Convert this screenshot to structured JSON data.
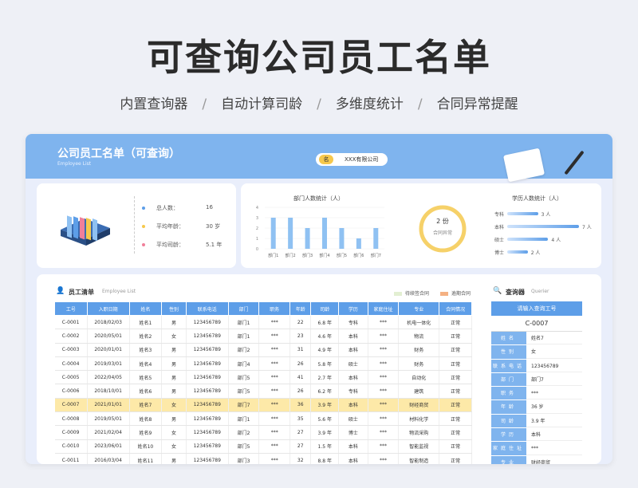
{
  "hero": {
    "title": "可查询公司员工名单",
    "features": [
      "内置查询器",
      "自动计算司龄",
      "多维度统计",
      "合同异常提醒"
    ],
    "separator": "/"
  },
  "banner": {
    "title": "公司员工名单（可查询）",
    "subtitle": "Employee List",
    "company_tag": "名",
    "company_name": "XXX有限公司"
  },
  "stats": {
    "items": [
      {
        "label": "总人数：",
        "value": "16",
        "color": "#5d9ee8"
      },
      {
        "label": "平均年龄：",
        "value": "30 岁",
        "color": "#f6c84c"
      },
      {
        "label": "平均司龄：",
        "value": "5.1 年",
        "color": "#f07f9a"
      }
    ]
  },
  "dept_chart": {
    "title": "部门人数统计（人）"
  },
  "contract": {
    "value": "2 份",
    "label": "合同异常"
  },
  "edu_chart": {
    "title": "学历人数统计（人）"
  },
  "chart_data": [
    {
      "type": "bar",
      "title": "部门人数统计（人）",
      "categories": [
        "部门1",
        "部门2",
        "部门3",
        "部门4",
        "部门5",
        "部门6",
        "部门7"
      ],
      "values": [
        3,
        3,
        2,
        3,
        2,
        1,
        2
      ],
      "ylim": [
        0,
        4
      ],
      "yticks": [
        "0",
        "1",
        "2",
        "3",
        "4"
      ]
    },
    {
      "type": "bar",
      "orientation": "horizontal",
      "title": "学历人数统计（人）",
      "categories": [
        "专科",
        "本科",
        "硕士",
        "博士"
      ],
      "values": [
        3,
        7,
        4,
        2
      ],
      "value_labels": [
        "3 人",
        "7 人",
        "4 人",
        "2 人"
      ]
    }
  ],
  "table": {
    "title": "员工清单",
    "title_en": "Employee List",
    "legend": [
      {
        "label": "待续签合同",
        "color": "#e3efd2"
      },
      {
        "label": "逾期合同",
        "color": "#f4b183"
      }
    ],
    "headers": [
      "工号",
      "入职日期",
      "姓名",
      "性别",
      "联系电话",
      "部门",
      "职务",
      "年龄",
      "司龄",
      "学历",
      "家庭住址",
      "专业",
      "合同情况"
    ],
    "rows": [
      [
        "C-0001",
        "2018/02/03",
        "姓名1",
        "男",
        "123456789",
        "部门1",
        "***",
        "22",
        "6.8 年",
        "专科",
        "***",
        "机电一体化",
        "正常"
      ],
      [
        "C-0002",
        "2020/05/01",
        "姓名2",
        "女",
        "123456789",
        "部门1",
        "***",
        "23",
        "4.6 年",
        "本科",
        "***",
        "物流",
        "正常"
      ],
      [
        "C-0003",
        "2020/01/01",
        "姓名3",
        "男",
        "123456789",
        "部门2",
        "***",
        "31",
        "4.9 年",
        "本科",
        "***",
        "财务",
        "正常"
      ],
      [
        "C-0004",
        "2019/03/01",
        "姓名4",
        "男",
        "123456789",
        "部门4",
        "***",
        "26",
        "5.8 年",
        "硕士",
        "***",
        "财务",
        "正常"
      ],
      [
        "C-0005",
        "2022/04/05",
        "姓名5",
        "男",
        "123456789",
        "部门5",
        "***",
        "41",
        "2.7 年",
        "本科",
        "***",
        "自动化",
        "正常"
      ],
      [
        "C-0006",
        "2018/10/01",
        "姓名6",
        "男",
        "123456789",
        "部门5",
        "***",
        "26",
        "6.2 年",
        "专科",
        "***",
        "建筑",
        "正常"
      ],
      [
        "C-0007",
        "2021/01/01",
        "姓名7",
        "女",
        "123456789",
        "部门7",
        "***",
        "36",
        "3.9 年",
        "本科",
        "***",
        "财经商贸",
        "正常"
      ],
      [
        "C-0008",
        "2019/05/01",
        "姓名8",
        "男",
        "123456789",
        "部门1",
        "***",
        "35",
        "5.6 年",
        "硕士",
        "***",
        "材料化学",
        "正常"
      ],
      [
        "C-0009",
        "2021/02/04",
        "姓名9",
        "女",
        "123456789",
        "部门2",
        "***",
        "27",
        "3.9 年",
        "博士",
        "***",
        "物流采购",
        "正常"
      ],
      [
        "C-0010",
        "2023/06/01",
        "姓名10",
        "女",
        "123456789",
        "部门5",
        "***",
        "27",
        "1.5 年",
        "本科",
        "***",
        "智能监视",
        "正常"
      ],
      [
        "C-0011",
        "2016/03/04",
        "姓名11",
        "男",
        "123456789",
        "部门3",
        "***",
        "32",
        "8.8 年",
        "本科",
        "***",
        "智能制造",
        "正常"
      ]
    ],
    "highlight_row": 6
  },
  "query": {
    "title": "查询器",
    "title_en": "Querier",
    "prompt": "请输入查询工号",
    "id": "C-0007",
    "fields": [
      {
        "label": "姓名",
        "value": "姓名7"
      },
      {
        "label": "性别",
        "value": "女"
      },
      {
        "label": "联系电话",
        "value": "123456789"
      },
      {
        "label": "部门",
        "value": "部门7"
      },
      {
        "label": "职务",
        "value": "***"
      },
      {
        "label": "年龄",
        "value": "36 岁"
      },
      {
        "label": "司龄",
        "value": "3.9 年"
      },
      {
        "label": "学历",
        "value": "本科"
      },
      {
        "label": "家庭住址",
        "value": "***"
      },
      {
        "label": "专业",
        "value": "财经商贸"
      }
    ]
  }
}
